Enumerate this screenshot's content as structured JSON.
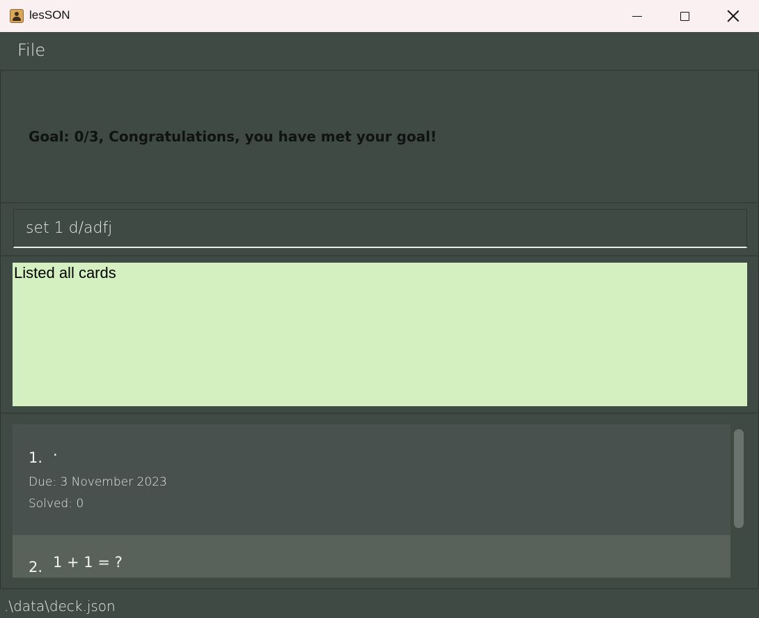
{
  "window": {
    "title": "lesSON",
    "icon": "address-book-icon"
  },
  "menu": {
    "file_label": "File"
  },
  "goal": {
    "text": "Goal: 0/3, Congratulations, you have met your goal!"
  },
  "command": {
    "value": "set 1 d/adfj"
  },
  "result": {
    "text": "Listed all cards"
  },
  "cards": [
    {
      "index": "1.",
      "question": "·",
      "due": "Due: 3 November 2023",
      "solved": "Solved: 0"
    },
    {
      "index": "2.",
      "question": "1 + 1 = ?"
    }
  ],
  "status": {
    "path": ".\\data\\deck.json"
  },
  "colors": {
    "background": "#3f4a45",
    "result_box": "#d4f0c0",
    "card_odd": "#48514d",
    "card_even": "#58625b",
    "titlebar": "#fbf0f1"
  }
}
